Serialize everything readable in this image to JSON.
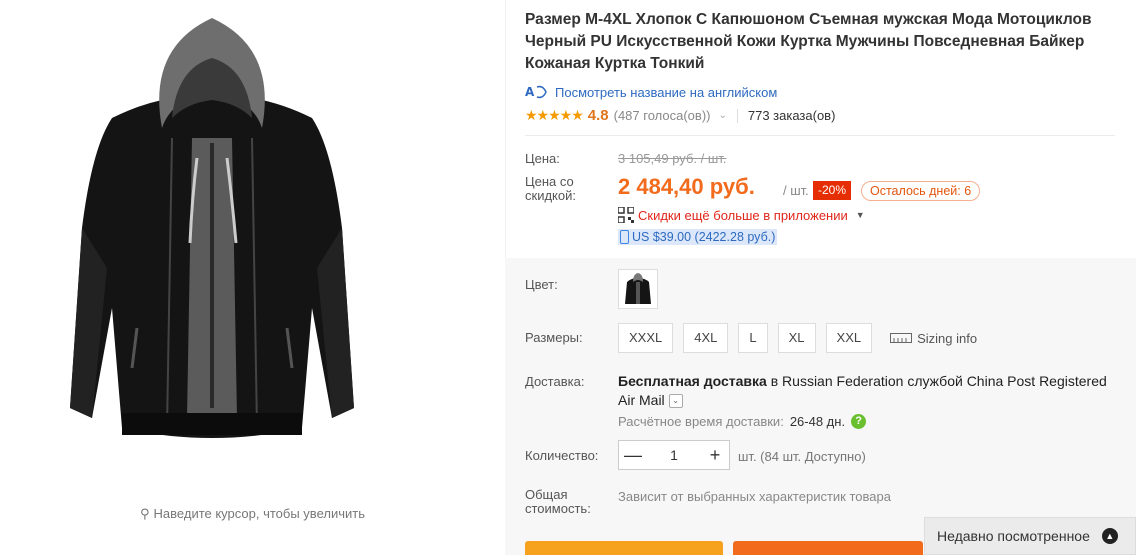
{
  "product": {
    "title": "Размер M-4XL Хлопок С Капюшоном Съемная мужская Мода Мотоциклов Черный PU Искусственной Кожи Куртка Мужчины Повседневная Байкер Кожаная Куртка Тонкий",
    "image_icon": "jacket-image",
    "zoom_hint": "Наведите курсор, чтобы увеличить"
  },
  "translate": {
    "icon": "translate-icon",
    "label": "Посмотреть название на английском"
  },
  "rating": {
    "stars": "★★★★★",
    "value": "4.8",
    "votes": "(487 голоса(ов))",
    "orders": "773 заказа(ов)"
  },
  "price": {
    "label": "Цена:",
    "old": "3 105,49 руб. / шт.",
    "discount_label": "Цена со скидкой:",
    "new": "2 484,40 руб.",
    "per_unit": "/ шт.",
    "discount_badge": "-20%",
    "days_left": "Осталось дней: 6",
    "app_discount": "Скидки ещё больше в приложении",
    "usd": "US $39.00 (2422.28 руб.)"
  },
  "options": {
    "color_label": "Цвет:",
    "sizes_label": "Размеры:",
    "sizes": [
      "XXXL",
      "4XL",
      "L",
      "XL",
      "XXL"
    ],
    "sizing_info": "Sizing info"
  },
  "delivery": {
    "label": "Доставка:",
    "free": "Бесплатная доставка",
    "to": "в Russian Federation службой China Post Registered Air Mail",
    "eta_label": "Расчётное время доставки:",
    "eta_days": "26-48 дн."
  },
  "quantity": {
    "label": "Количество:",
    "value": "1",
    "minus": "—",
    "plus": "+",
    "available": "шт. (84 шт. Доступно)"
  },
  "total": {
    "label": "Общая стоимость:",
    "value": "Зависит от выбранных характеристик товара"
  },
  "recently_viewed": "Недавно посмотренное",
  "colors": {
    "accent_orange": "#f26b1d",
    "badge_red": "#e62e04",
    "link_blue": "#2e6ac0",
    "star": "#f59b00"
  }
}
